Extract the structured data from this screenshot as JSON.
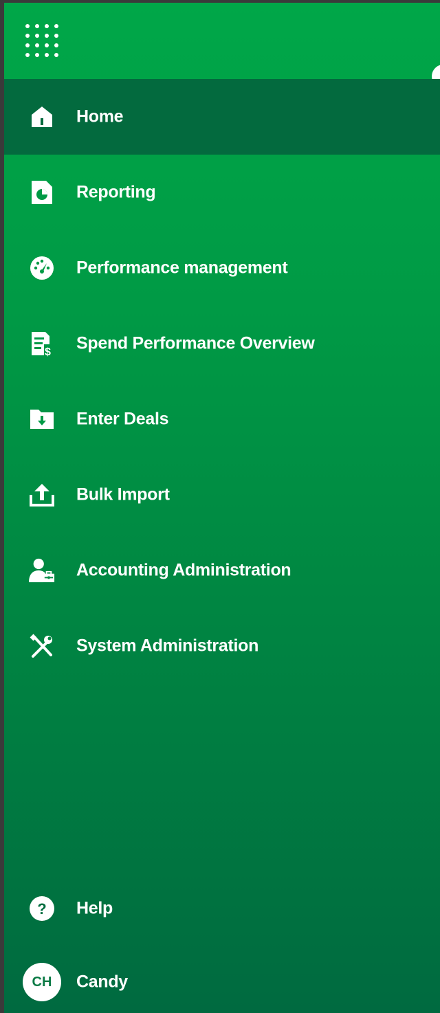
{
  "sidebar": {
    "items": [
      {
        "label": "Home",
        "icon": "home-icon",
        "active": true
      },
      {
        "label": "Reporting",
        "icon": "report-icon",
        "active": false
      },
      {
        "label": "Performance management",
        "icon": "speedometer-icon",
        "active": false
      },
      {
        "label": "Spend Performance Overview",
        "icon": "spend-document-icon",
        "active": false
      },
      {
        "label": "Enter Deals",
        "icon": "folder-download-icon",
        "active": false
      },
      {
        "label": "Bulk Import",
        "icon": "upload-icon",
        "active": false
      },
      {
        "label": "Accounting Administration",
        "icon": "user-briefcase-icon",
        "active": false
      },
      {
        "label": "System Administration",
        "icon": "tools-icon",
        "active": false
      }
    ],
    "help": {
      "label": "Help",
      "icon": "help-icon"
    },
    "user": {
      "initials": "CH",
      "name": "Candy"
    }
  },
  "colors": {
    "gradient_top": "#00a748",
    "gradient_bottom": "#006a40",
    "active_bg": "#036a3e",
    "text": "#ffffff"
  }
}
